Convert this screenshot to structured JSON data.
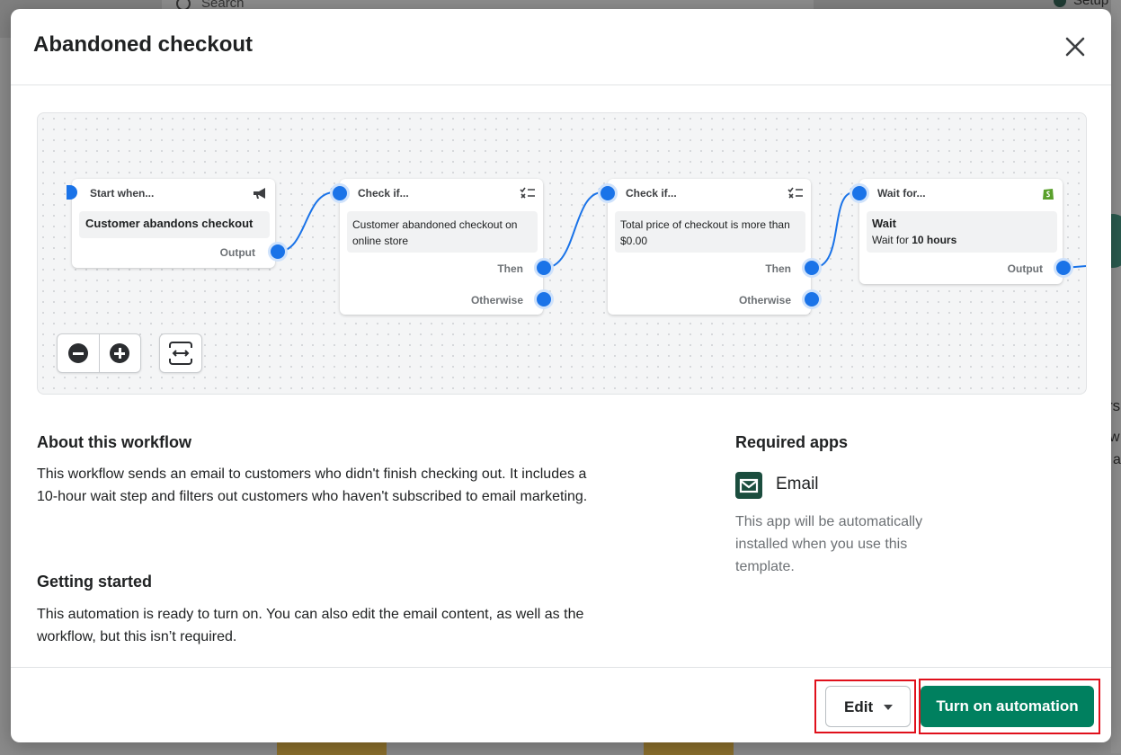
{
  "background": {
    "search_placeholder": "Search",
    "setup_label": "Setup"
  },
  "modal": {
    "title": "Abandoned checkout",
    "close_icon": "close-icon"
  },
  "workflow": {
    "nodes": [
      {
        "type": "trigger",
        "head": "Start when...",
        "body": "Customer abandons checkout",
        "icon": "megaphone-icon",
        "port_label": "Output"
      },
      {
        "type": "condition",
        "head": "Check if...",
        "body": "Customer abandoned checkout on online store",
        "icon": "checklist-icon",
        "then_label": "Then",
        "otherwise_label": "Otherwise"
      },
      {
        "type": "condition",
        "head": "Check if...",
        "body": "Total price of checkout is more than $0.00",
        "icon": "checklist-icon",
        "then_label": "Then",
        "otherwise_label": "Otherwise"
      },
      {
        "type": "action",
        "head": "Wait for...",
        "body_title": "Wait",
        "body_prefix": "Wait for ",
        "body_value": "10 hours",
        "icon": "shopify-icon",
        "port_label": "Output"
      }
    ],
    "controls": [
      "zoom-out-icon",
      "zoom-in-icon",
      "fit-to-screen-icon"
    ]
  },
  "about": {
    "heading": "About this workflow",
    "text": "This workflow sends an email to customers who didn't finish checking out. It includes a 10-hour wait step and filters out customers who haven't subscribed to email marketing."
  },
  "getting_started": {
    "heading": "Getting started",
    "text": "This automation is ready to turn on. You can also edit the email content, as well as the workflow, but this isn’t required."
  },
  "required_apps": {
    "heading": "Required apps",
    "app_name": "Email",
    "app_icon": "email-icon",
    "note": "This app will be automatically installed when you use this template."
  },
  "footer": {
    "edit_label": "Edit",
    "primary_label": "Turn on automation"
  },
  "colors": {
    "primary": "#00805f",
    "port": "#1a73e8",
    "highlight": "#e0101b",
    "email_icon": "#1b4d3e"
  }
}
